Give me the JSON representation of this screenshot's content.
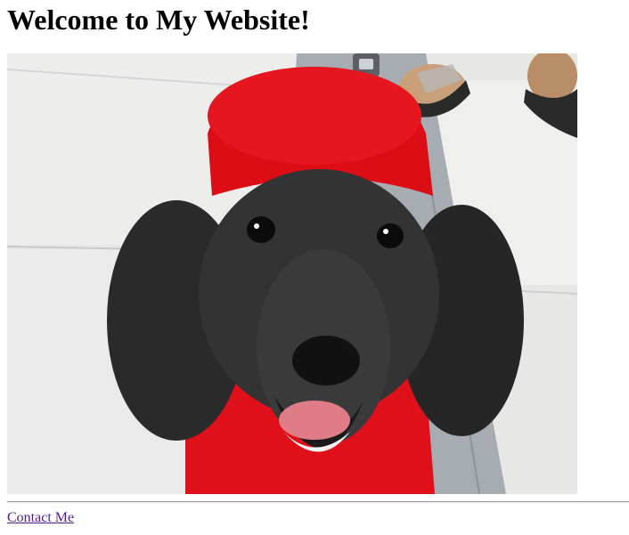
{
  "page": {
    "heading": "Welcome to My Website!",
    "contact_link_label": "Contact Me"
  },
  "image": {
    "subject": "black poodle wearing a red sweater and red hood",
    "icon": "dog-photo"
  },
  "colors": {
    "link_visited": "#551a8b",
    "sweater_red": "#e0101a",
    "floor": "#ececec",
    "fur": "#2b2b2b"
  }
}
